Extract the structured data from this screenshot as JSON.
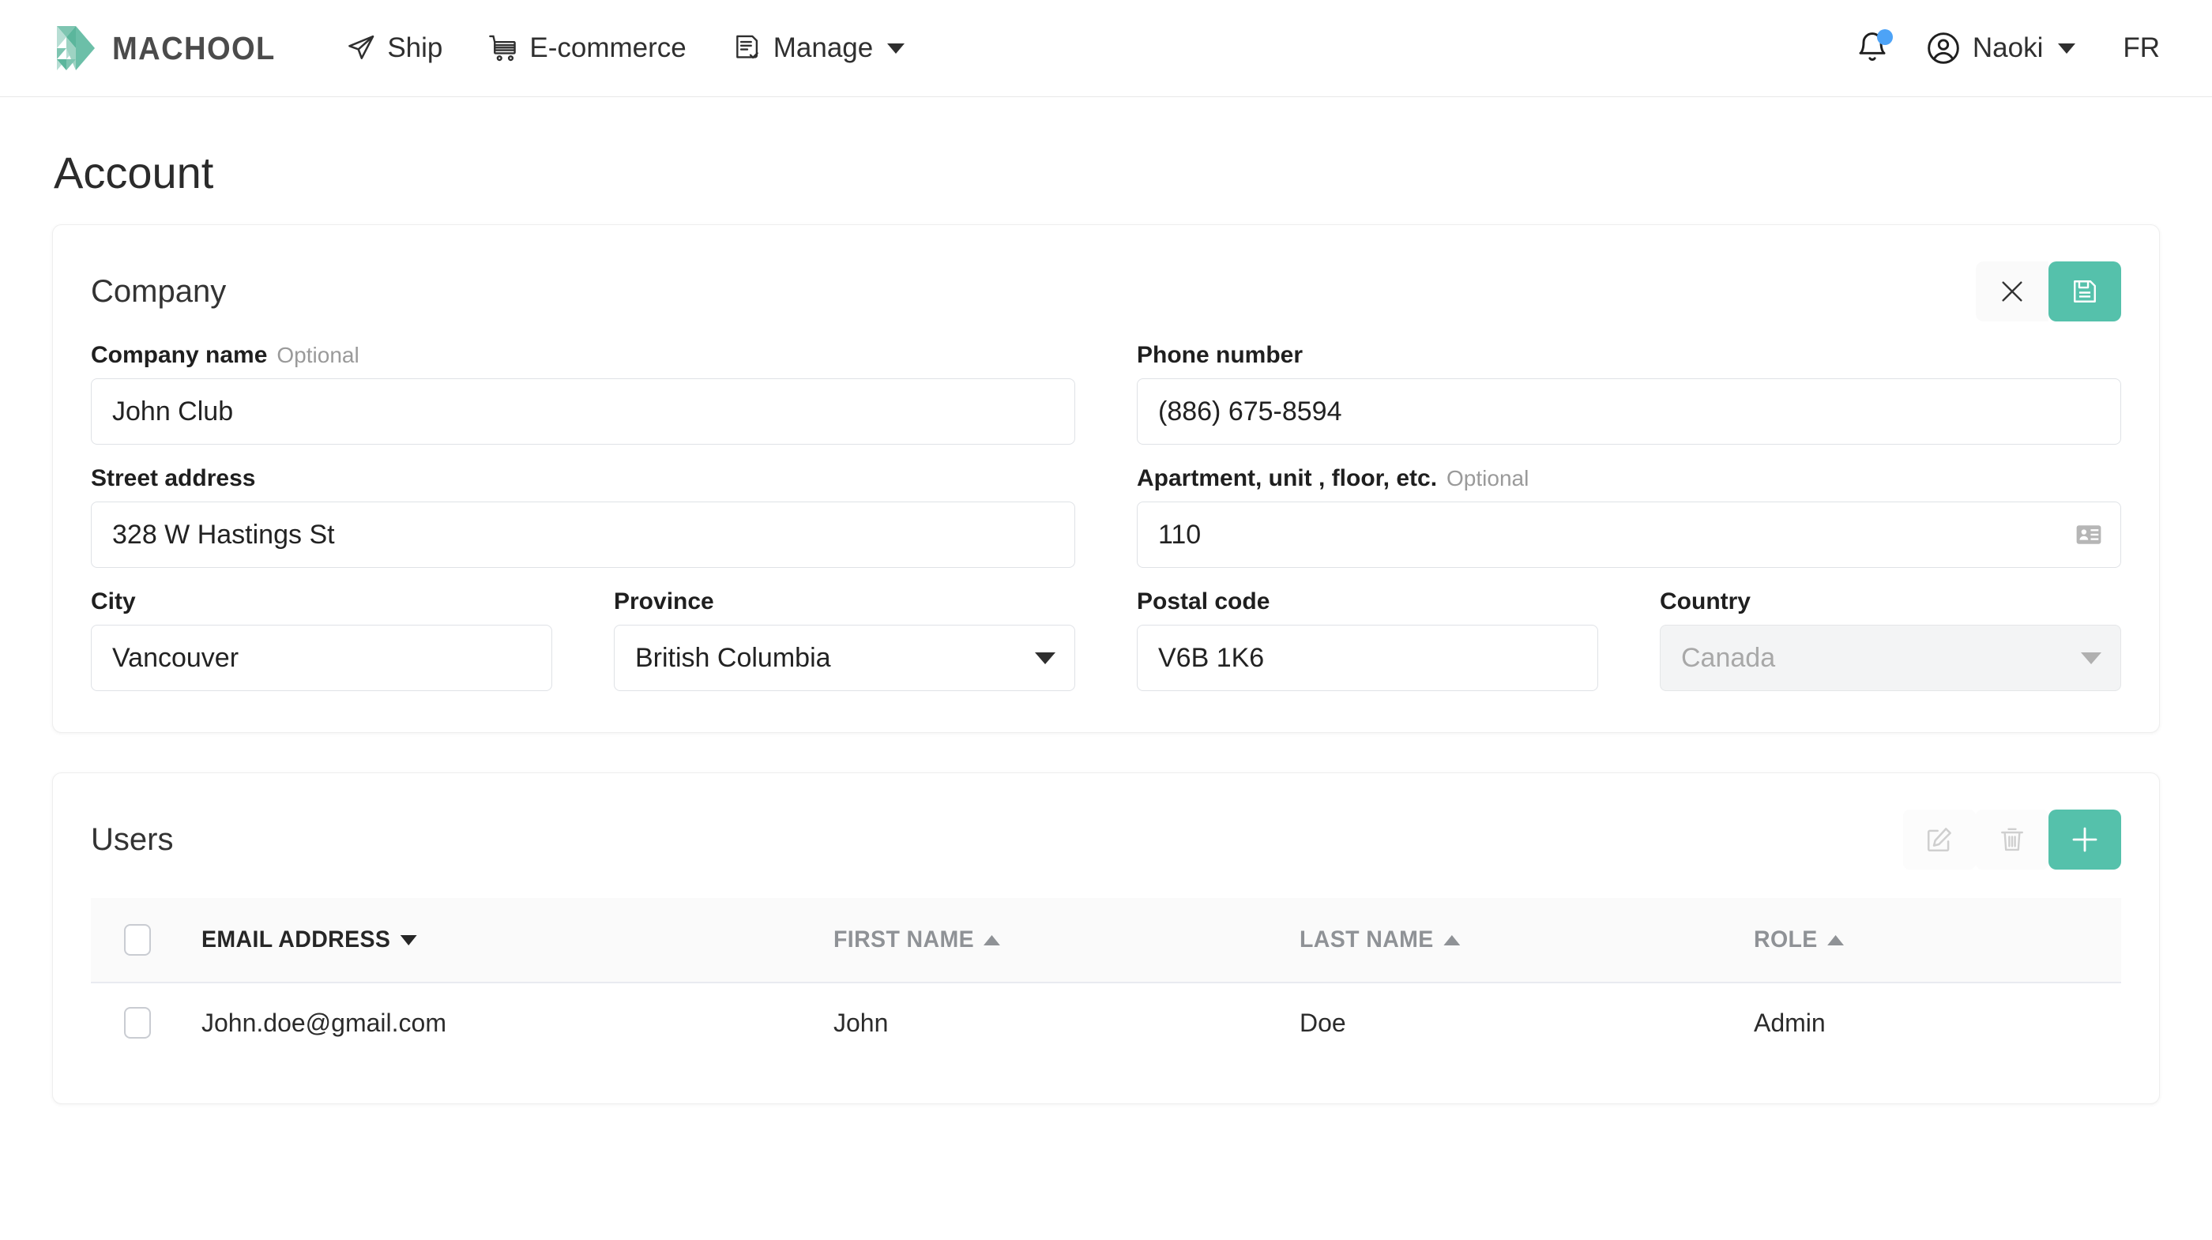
{
  "brand": {
    "name": "MACHOOL",
    "logo_icon": "machool-triangles-logo"
  },
  "nav": [
    {
      "label": "Ship",
      "icon": "paper-plane-icon",
      "has_caret": false
    },
    {
      "label": "E-commerce",
      "icon": "shopping-cart-icon",
      "has_caret": false
    },
    {
      "label": "Manage",
      "icon": "document-check-icon",
      "has_caret": true
    }
  ],
  "header_right": {
    "notifications_icon": "bell-icon",
    "has_notification_dot": true,
    "notification_dot_color": "#4da3f7",
    "avatar_icon": "user-circle-icon",
    "user_name": "Naoki",
    "language": "FR"
  },
  "page": {
    "title": "Account"
  },
  "company": {
    "title": "Company",
    "actions": {
      "cancel_icon": "close-x-icon",
      "save_icon": "floppy-disk-save-icon"
    },
    "fields": {
      "company_name": {
        "label": "Company name",
        "optional": "Optional",
        "value": "John Club"
      },
      "phone_number": {
        "label": "Phone number",
        "value": "(886) 675-8594"
      },
      "street_address": {
        "label": "Street address",
        "value": "328 W Hastings St"
      },
      "apartment": {
        "label": "Apartment, unit , floor, etc.",
        "optional": "Optional",
        "value": "110",
        "affix_icon": "address-card-icon"
      },
      "city": {
        "label": "City",
        "value": "Vancouver"
      },
      "province": {
        "label": "Province",
        "value": "British Columbia"
      },
      "postal_code": {
        "label": "Postal code",
        "value": "V6B 1K6"
      },
      "country": {
        "label": "Country",
        "value": "Canada",
        "disabled": true
      }
    }
  },
  "users": {
    "title": "Users",
    "actions": {
      "edit_icon": "edit-pencil-icon",
      "delete_icon": "trash-icon",
      "add_icon": "plus-icon"
    },
    "columns": [
      {
        "key": "email",
        "label": "EMAIL ADDRESS",
        "sort": "desc",
        "active": true
      },
      {
        "key": "first",
        "label": "FIRST NAME",
        "sort": "asc",
        "active": false
      },
      {
        "key": "last",
        "label": "LAST NAME",
        "sort": "asc",
        "active": false
      },
      {
        "key": "role",
        "label": "ROLE",
        "sort": "asc",
        "active": false
      }
    ],
    "rows": [
      {
        "email": "John.doe@gmail.com",
        "first": "John",
        "last": "Doe",
        "role": "Admin"
      }
    ]
  },
  "colors": {
    "accent": "#55c1ab",
    "accent_light": "#a8d8cd",
    "text": "#2b2b2b",
    "muted": "#9a9a9a",
    "border": "#dfe2e6"
  }
}
